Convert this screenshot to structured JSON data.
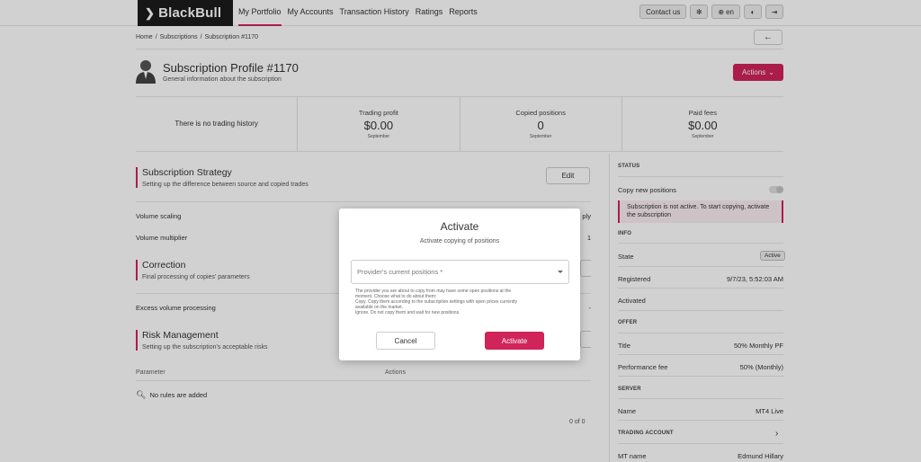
{
  "header": {
    "logo": "BlackBull",
    "nav": [
      "My Portfolio",
      "My Accounts",
      "Transaction History",
      "Ratings",
      "Reports"
    ],
    "contact": "Contact us",
    "lang": "en"
  },
  "breadcrumb": [
    "Home",
    "/",
    "Subscriptions",
    "/",
    "Subscription #1170"
  ],
  "profile": {
    "title": "Subscription Profile #1170",
    "subtitle": "General information about the subscription",
    "actions": "Actions"
  },
  "stats": {
    "no_history": "There is no trading history",
    "items": [
      {
        "label": "Trading profit",
        "value": "$0.00",
        "period": "September"
      },
      {
        "label": "Copied positions",
        "value": "0",
        "period": "September"
      },
      {
        "label": "Paid fees",
        "value": "$0.00",
        "period": "September"
      }
    ]
  },
  "strategy": {
    "title": "Subscription Strategy",
    "subtitle": "Setting up the difference between source and copied trades",
    "edit": "Edit",
    "rows": [
      {
        "label": "Volume scaling",
        "value": "ply"
      },
      {
        "label": "Volume multiplier",
        "value": "1"
      }
    ]
  },
  "correction": {
    "title": "Correction",
    "subtitle": "Final processing of copies' parameters",
    "rows": [
      {
        "label": "Excess volume processing",
        "value": "-"
      }
    ]
  },
  "risk": {
    "title": "Risk Management",
    "subtitle": "Setting up the subscription's acceptable risks",
    "col_parameter": "Parameter",
    "col_actions": "Actions",
    "no_rules": "No rules are added",
    "pager": "0 of 0"
  },
  "sidebar": {
    "status_label": "STATUS",
    "copy_new": "Copy new positions",
    "alert": "Subscription is not active. To start copying, activate the subscription",
    "info_label": "INFO",
    "state_key": "State",
    "state_val": "Active",
    "registered_key": "Registered",
    "registered_val": "9/7/23, 5:52:03 AM",
    "activated_key": "Activated",
    "offer_label": "OFFER",
    "title_key": "Title",
    "title_val": "50% Monthly PF",
    "perf_key": "Performance fee",
    "perf_val": "50% (Monthly)",
    "server_label": "SERVER",
    "name_key": "Name",
    "name_val": "MT4 Live",
    "trading_label": "TRADING ACCOUNT",
    "mtname_key": "MT name",
    "mtname_val": "Edmund Hillary"
  },
  "modal": {
    "title": "Activate",
    "subtitle": "Activate copying of positions",
    "placeholder": "Provider's current positions *",
    "help": [
      "The provider you are about to copy from may have some open positions at the",
      "moment. Choose what to do about them:",
      "Copy. Copy them according to the subscription settings with open prices currently",
      "available on the market.",
      "Ignore. Do not copy them and wait for new positions."
    ],
    "cancel": "Cancel",
    "activate": "Activate"
  },
  "colors": {
    "accent": "#d0245a",
    "logo_bg": "#1c1c1c"
  }
}
